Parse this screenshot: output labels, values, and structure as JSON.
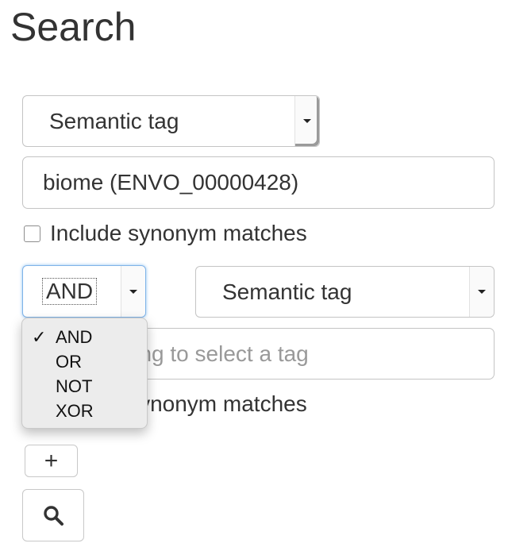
{
  "page": {
    "title": "Search"
  },
  "row1": {
    "type_select": "Semantic tag",
    "tag_value": "biome (ENVO_00000428)",
    "synonym_label": "Include synonym matches",
    "synonym_checked": false
  },
  "row2": {
    "operator": "AND",
    "operator_options": [
      "AND",
      "OR",
      "NOT",
      "XOR"
    ],
    "type_select": "Semantic tag",
    "tag_placeholder": "Start typing to select a tag",
    "synonym_label": "Include synonym matches",
    "synonym_checked": false
  },
  "buttons": {
    "add_label": "+",
    "search_icon": "magnifier-icon"
  },
  "colors": {
    "focus_border": "#7fb3e8",
    "dropdown_bg": "#ececec"
  }
}
